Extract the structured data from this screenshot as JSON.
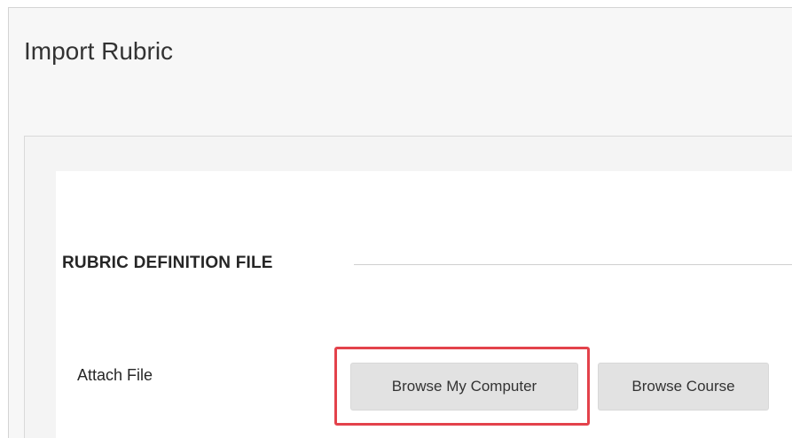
{
  "header": {
    "title": "Import Rubric"
  },
  "section": {
    "heading": "RUBRIC DEFINITION FILE"
  },
  "attach": {
    "label": "Attach File",
    "browse_computer_label": "Browse My Computer",
    "browse_course_label": "Browse Course"
  },
  "colors": {
    "highlight": "#e3424b",
    "button_bg": "#e2e2e2",
    "page_bg": "#f7f7f7"
  }
}
